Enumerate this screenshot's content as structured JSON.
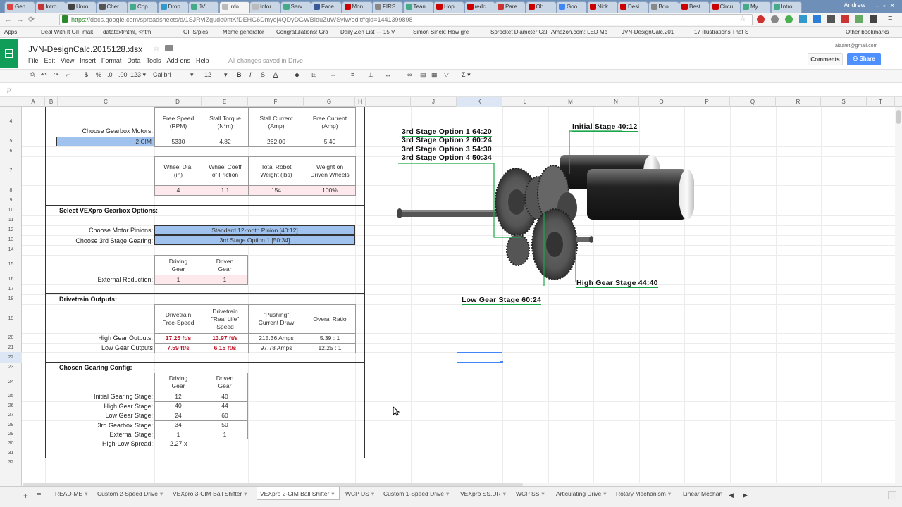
{
  "browser": {
    "tabs": [
      "Gen",
      "Intro",
      "Unro",
      "Cher",
      "Cop",
      "Drop",
      "JV",
      "Info",
      "Infor",
      "Serv",
      "Face",
      "Mon",
      "FIRS",
      "Tean",
      "Hop",
      "redc",
      "Pare",
      "Oh",
      "Goo",
      "Nick",
      "Desi",
      "Bdo",
      "Best",
      "Circu",
      "My",
      "Intro"
    ],
    "profile": "Andrew",
    "url_https": "https://",
    "url_rest": "docs.google.com/spreadsheets/d/1SJRyIZgudo0ntKfDEHG6Dmyej4QDyDGWBIduZuWSyiw/edit#gid=1441399898",
    "bookmarks": [
      "Apps",
      "Deal With It GIF mak",
      "datatext/html, <htm",
      "GIFS/pics",
      "Meme generator",
      "Congratulations! Gra",
      "Daily Zen List — 15 V",
      "Simon Sinek: How gre",
      "Sprocket Diameter Cal",
      "Amazon.com: LED Mo",
      "JVN-DesignCalc.201",
      "17 Illustrations That S",
      "Other bookmarks"
    ]
  },
  "sheets": {
    "title": "JVN-DesignCalc.2015128.xlsx",
    "account": "alaaret@gmail.com",
    "comments_label": "Comments",
    "share_label": "Share",
    "menu": [
      "File",
      "Edit",
      "View",
      "Insert",
      "Format",
      "Data",
      "Tools",
      "Add-ons",
      "Help"
    ],
    "save_status": "All changes saved in Drive",
    "font": "Calibri",
    "font_size": "12",
    "fx": "fx",
    "columns": [
      "A",
      "B",
      "C",
      "D",
      "E",
      "F",
      "G",
      "H",
      "I",
      "J",
      "K",
      "L",
      "M",
      "N",
      "O",
      "P",
      "Q",
      "R",
      "S",
      "T"
    ],
    "rows": [
      "4",
      "5",
      "6",
      "7",
      "8",
      "9",
      "10",
      "11",
      "12",
      "13",
      "14",
      "15",
      "16",
      "17",
      "18",
      "19",
      "20",
      "21",
      "22",
      "23",
      "24",
      "25",
      "26",
      "27",
      "28",
      "29",
      "30",
      "31",
      "32"
    ]
  },
  "calc": {
    "motor_headers": [
      "Free Speed\n(RPM)",
      "Stall Torque\n(N*m)",
      "Stall Current\n(Amp)",
      "Free Current\n(Amp)"
    ],
    "choose_motors_label": "Choose Gearbox Motors:",
    "motor_value": "2 CIM",
    "motor_values": [
      "5330",
      "4.82",
      "262.00",
      "5.40"
    ],
    "wheel_headers": [
      "Wheel Dia.\n(in)",
      "Wheel Coeff\nof Friction",
      "Total Robot\nWeight (lbs)",
      "Weight on\nDriven Wheels"
    ],
    "wheel_values": [
      "4",
      "1.1",
      "154",
      "100%"
    ],
    "section_vexpro": "Select VEXpro Gearbox Options:",
    "motor_pinions_label": "Choose Motor Pinions:",
    "motor_pinions_value": "Standard 12-tooth Pinion [40:12]",
    "third_stage_label": "Choose 3rd Stage Gearing:",
    "third_stage_value": "3rd Stage Option 1 [50:34]",
    "ext_headers": [
      "Driving\nGear",
      "Driven\nGear"
    ],
    "ext_label": "External Reduction:",
    "ext_values": [
      "1",
      "1"
    ],
    "section_outputs": "Drivetrain Outputs:",
    "out_headers": [
      "Drivetrain\nFree-Speed",
      "Drivetrain\n\"Real Life\"\nSpeed",
      "\"Pushing\"\nCurrent Draw",
      "Overal Ratio"
    ],
    "high_label": "High Gear Outputs:",
    "high_values": [
      "17.25 ft/s",
      "13.97 ft/s",
      "215.36 Amps",
      "5.39 : 1"
    ],
    "low_label": "Low Gear Outputs",
    "low_values": [
      "7.59 ft/s",
      "6.15 ft/s",
      "97.78 Amps",
      "12.25 : 1"
    ],
    "section_config": "Chosen Gearing Config:",
    "cfg_headers": [
      "Driving\nGear",
      "Driven\nGear"
    ],
    "cfg_rows": [
      {
        "label": "Initial Gearing Stage:",
        "a": "12",
        "b": "40"
      },
      {
        "label": "High Gear Stage:",
        "a": "40",
        "b": "44"
      },
      {
        "label": "Low Gear Stage:",
        "a": "24",
        "b": "60"
      },
      {
        "label": "3rd Gearbox Stage:",
        "a": "34",
        "b": "50"
      },
      {
        "label": "External Stage:",
        "a": "1",
        "b": "1"
      }
    ],
    "spread_label": "High-Low Spread:",
    "spread_value": "2.27 x"
  },
  "diagram": {
    "options": [
      "3rd Stage Option 1 64:20",
      "3rd Stage Option 2 60:24",
      "3rd Stage Option 3 54:30",
      "3rd Stage Option 4 50:34"
    ],
    "initial": "Initial Stage 40:12",
    "high": "High Gear Stage 44:40",
    "low": "Low Gear Stage 60:24"
  },
  "sheet_tabs": [
    "READ-ME",
    "Custom 2-Speed Drive",
    "VEXpro 3-CIM Ball Shifter",
    "VEXpro 2-CIM Ball Shifter",
    "WCP DS",
    "Custom 1-Speed Drive",
    "VEXpro SS,DR",
    "WCP SS",
    "Articulating Drive",
    "Rotary Mechanism",
    "Linear Mechan"
  ],
  "colors": {
    "accent_green": "#0f9d58",
    "share_blue": "#4285f4",
    "selector_blue": "#9fc3ee",
    "output_red": "#c0162a"
  }
}
